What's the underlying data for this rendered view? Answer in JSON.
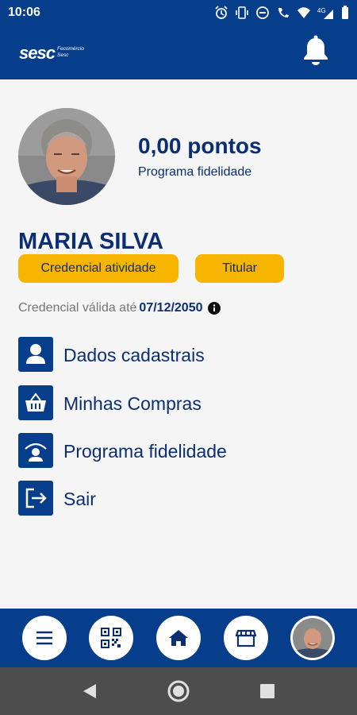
{
  "status_bar": {
    "time": "10:06",
    "network": "4G"
  },
  "header": {
    "logo_text": "sesc",
    "logo_subtext_1": "Fecomércio",
    "logo_subtext_2": "Sesc"
  },
  "profile": {
    "points": "0,00 pontos",
    "points_label": "Programa fidelidade",
    "name": "MARIA SILVA",
    "badges": [
      "Credencial atividade",
      "Titular"
    ],
    "validity_label": "Credencial válida até",
    "validity_date": "07/12/2050"
  },
  "menu": [
    {
      "label": "Dados cadastrais",
      "icon": "user-icon"
    },
    {
      "label": "Minhas Compras",
      "icon": "basket-icon"
    },
    {
      "label": "Programa fidelidade",
      "icon": "loyalty-icon"
    },
    {
      "label": "Sair",
      "icon": "logout-icon"
    }
  ],
  "bottom_nav": [
    "menu-icon",
    "qr-code-icon",
    "home-icon",
    "store-icon",
    "profile-avatar"
  ],
  "colors": {
    "primary": "#063e8c",
    "accent": "#f8b500",
    "text": "#0b2e73"
  }
}
